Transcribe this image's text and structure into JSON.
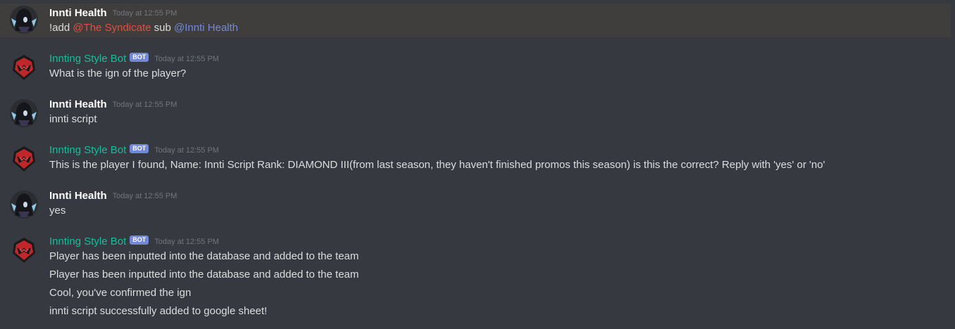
{
  "colors": {
    "background": "#36393f",
    "highlight_bg": "#3f3e3d",
    "bot_name": "#1abc9c",
    "bot_tag": "#7289da",
    "role_mention": "#e74c3c",
    "user_mention": "#7289da",
    "timestamp": "#72767d"
  },
  "messages": [
    {
      "author": "Innti Health",
      "avatar": "dark-hooded-avatar-icon",
      "timestamp": "Today at 12:55 PM",
      "command": "!add",
      "role_mention": "@The Syndicate",
      "middle": "sub",
      "user_mention": "@Innti Health"
    },
    {
      "author": "Innting Style Bot",
      "bot_tag": "BOT",
      "avatar": "red-crest-bot-icon",
      "timestamp": "Today at 12:55 PM",
      "lines": [
        "What is the ign of the player?"
      ]
    },
    {
      "author": "Innti Health",
      "avatar": "dark-hooded-avatar-icon",
      "timestamp": "Today at 12:55 PM",
      "lines": [
        "innti script"
      ]
    },
    {
      "author": "Innting Style Bot",
      "bot_tag": "BOT",
      "avatar": "red-crest-bot-icon",
      "timestamp": "Today at 12:55 PM",
      "lines": [
        "This is the player I found, Name: Innti Script Rank: DIAMOND III(from last season, they haven't finished promos this season) is this the correct? Reply with 'yes' or 'no'"
      ]
    },
    {
      "author": "Innti Health",
      "avatar": "dark-hooded-avatar-icon",
      "timestamp": "Today at 12:55 PM",
      "lines": [
        "yes"
      ]
    },
    {
      "author": "Innting Style Bot",
      "bot_tag": "BOT",
      "avatar": "red-crest-bot-icon",
      "timestamp": "Today at 12:55 PM",
      "lines": [
        "Player has been inputted into the database and added to the team",
        "Player has been inputted into the database and added to the team",
        "Cool, you've confirmed the ign",
        "innti script successfully added to google sheet!"
      ]
    }
  ]
}
